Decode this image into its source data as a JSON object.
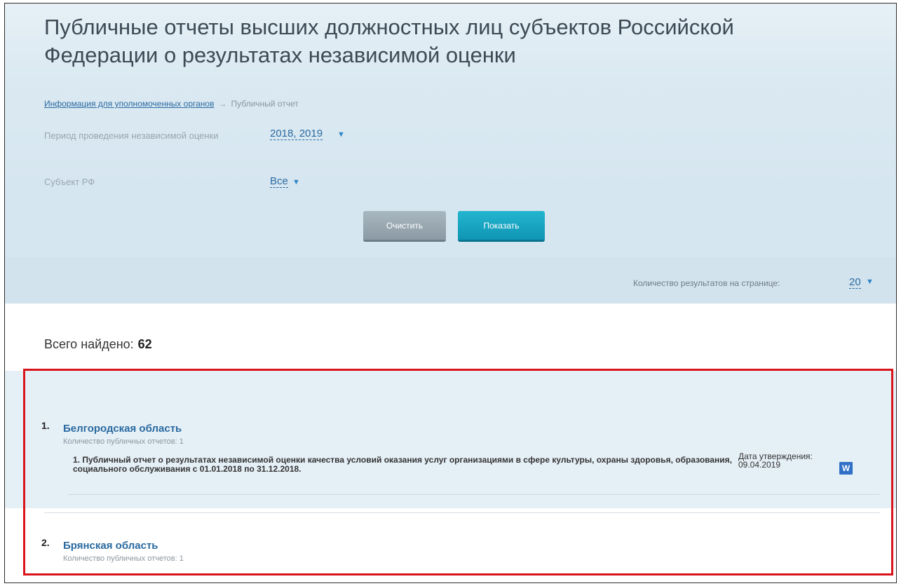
{
  "page": {
    "title": "Публичные отчеты высших должностных лиц субъектов Российской Федерации о результатах независимой оценки"
  },
  "breadcrumb": {
    "link": "Информация для уполномоченных органов",
    "separator": "→",
    "current": "Публичный отчет"
  },
  "filters": {
    "period": {
      "label": "Период проведения независимой оценки",
      "value": "2018, 2019"
    },
    "subject": {
      "label": "Субъект РФ",
      "value": "Все"
    },
    "arrow_glyph": "▼"
  },
  "buttons": {
    "clear_label": "Очистить",
    "show_label": "Показать"
  },
  "pagination": {
    "per_page_label": "Количество результатов на странице:",
    "per_page_value": "20"
  },
  "results": {
    "total_label": "Всего найдено:",
    "total_count": "62",
    "items": [
      {
        "number": "1.",
        "region": "Белгородская область",
        "report_count_label": "Количество публичных отчетов: 1",
        "reports": [
          {
            "text": "1. Публичный отчет о результатах независимой оценки качества условий оказания услуг организациями в сфере культуры, охраны здоровья, образования, социального обслуживания с 01.01.2018 по 31.12.2018.",
            "date_label": "Дата утверждения:",
            "date": "09.04.2019",
            "file_icon_letter": "W"
          }
        ]
      },
      {
        "number": "2.",
        "region": "Брянская область",
        "report_count_label": "Количество публичных отчетов: 1"
      }
    ]
  },
  "colors": {
    "link": "#2a6aa0",
    "accent_button": "#12a4c2",
    "highlight_border": "#d9141b",
    "panel_bg": "#d6e6f0"
  }
}
